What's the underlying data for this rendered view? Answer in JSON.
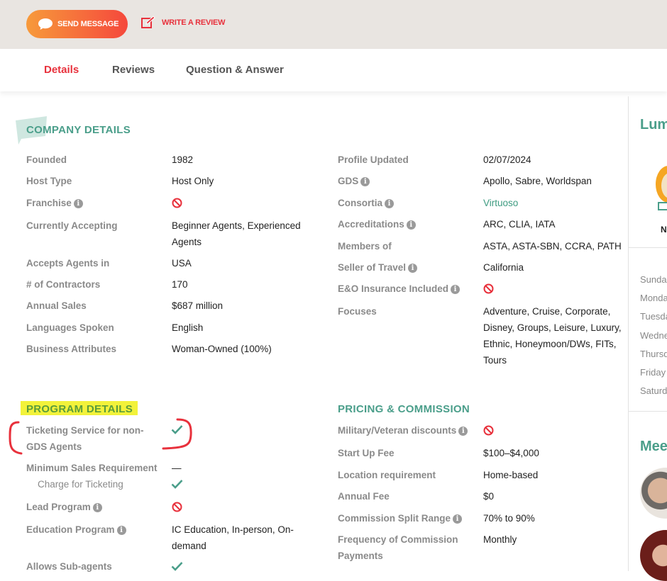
{
  "top": {
    "send_label": "SEND MESSAGE",
    "review_label": "WRITE A REVIEW"
  },
  "tabs": [
    "Details",
    "Reviews",
    "Question & Answer"
  ],
  "company": {
    "title": "COMPANY DETAILS",
    "left": [
      {
        "label": "Founded",
        "value": "1982"
      },
      {
        "label": "Host Type",
        "value": "Host Only"
      },
      {
        "label": "Franchise",
        "value": ""
      },
      {
        "label": "Currently Accepting",
        "value": "Beginner Agents, Experienced Agents"
      },
      {
        "label": "Accepts Agents in",
        "value": "USA"
      },
      {
        "label": "# of Contractors",
        "value": "170"
      },
      {
        "label": "Annual Sales",
        "value": "$687 million"
      },
      {
        "label": "Languages Spoken",
        "value": "English"
      },
      {
        "label": "Business Attributes",
        "value": "Woman-Owned (100%)"
      }
    ],
    "right": [
      {
        "label": "Profile Updated",
        "value": "02/07/2024"
      },
      {
        "label": "GDS",
        "value": "Apollo, Sabre, Worldspan"
      },
      {
        "label": "Consortia",
        "value": "Virtuoso"
      },
      {
        "label": "Accreditations",
        "value": "ARC, CLIA, IATA"
      },
      {
        "label": "Members of",
        "value": "ASTA, ASTA-SBN, CCRA, PATH"
      },
      {
        "label": "Seller of Travel",
        "value": "California"
      },
      {
        "label": "E&O Insurance Included",
        "value": ""
      },
      {
        "label": "Focuses",
        "value": "Adventure, Cruise, Corporate, Disney, Groups, Leisure, Luxury, Ethnic, Honeymoon/DWs, FITs, Tours"
      }
    ]
  },
  "program": {
    "title": "PROGRAM DETAILS",
    "rows": [
      {
        "label": "Ticketing Service for non-GDS Agents",
        "value": ""
      },
      {
        "label": "Minimum Sales Requirement",
        "value": "—"
      },
      {
        "label": "Charge for Ticketing",
        "value": ""
      },
      {
        "label": "Lead Program",
        "value": ""
      },
      {
        "label": "Education Program",
        "value": "IC Education, In-person, On-demand"
      },
      {
        "label": "Allows Sub-agents",
        "value": ""
      }
    ]
  },
  "pricing": {
    "title": "PRICING & COMMISSION",
    "rows": [
      {
        "label": "Military/Veteran discounts",
        "value": ""
      },
      {
        "label": "Start Up Fee",
        "value": "$100–$4,000"
      },
      {
        "label": "Location requirement",
        "value": "Home-based"
      },
      {
        "label": "Annual Fee",
        "value": "$0"
      },
      {
        "label": "Commission Split Range",
        "value": "70% to 90%"
      },
      {
        "label": "Frequency of Commission Payments",
        "value": "Monthly"
      }
    ]
  },
  "sidebar": {
    "title": "Lum",
    "badge_text": "N",
    "days": [
      "Sunda",
      "Monda",
      "Tuesda",
      "Wedne",
      "Thursd",
      "Friday",
      "Saturd"
    ],
    "meet_title": "Mee"
  },
  "colors": {
    "accent": "#e8313c",
    "teal": "#4a9e8a",
    "check": "#4a9e8a",
    "no": "#e8313c",
    "highlight": "#f2f23a",
    "annotation": "#e8313c"
  },
  "icons": {
    "send": "chat-bubble-icon",
    "review": "edit-icon",
    "info": "info-icon",
    "no": "prohibited-icon",
    "yes": "checkmark-icon"
  }
}
